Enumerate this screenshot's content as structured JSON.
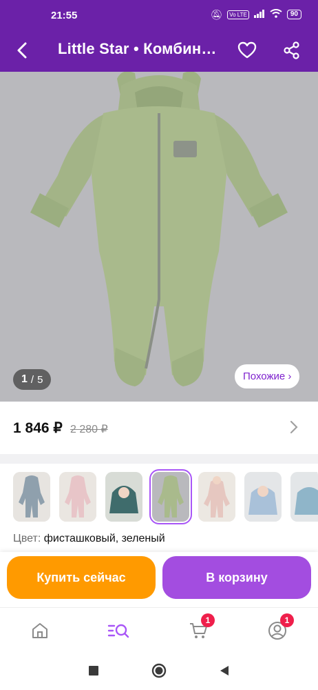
{
  "status_bar": {
    "time": "21:55",
    "sim_label": "Vo LTE",
    "battery": "90"
  },
  "header": {
    "title": "Little Star • Комбинезон",
    "icons": [
      "back-arrow-icon",
      "heart-icon",
      "share-icon"
    ]
  },
  "gallery": {
    "current": "1",
    "separator": "/",
    "total": "5",
    "similar_label": "Похожие ›",
    "background_color": "#b9b9bd",
    "garment_color": "#a9ba8c"
  },
  "price": {
    "current": "1 846 ₽",
    "old": "2 280 ₽"
  },
  "variants": {
    "thumbnails": [
      {
        "color": "#8fa0ad",
        "selected": false
      },
      {
        "color": "#e8c5c8",
        "selected": false
      },
      {
        "color": "#3f6c6c",
        "selected": false
      },
      {
        "color": "#a9ba8c",
        "selected": true
      },
      {
        "color": "#e6c7c0",
        "selected": false
      },
      {
        "color": "#a9c1d9",
        "selected": false
      },
      {
        "color": "#8fb5c9",
        "selected": false
      }
    ],
    "color_label": "Цвет:",
    "color_value": "фисташковый, зеленый"
  },
  "actions": {
    "buy_now": "Купить сейчас",
    "add_to_cart": "В корзину",
    "buy_color": "#ff9a00",
    "cart_color": "#a34de0"
  },
  "bottom_nav": {
    "items": [
      {
        "icon": "home-icon",
        "badge": ""
      },
      {
        "icon": "catalog-search-icon",
        "badge": ""
      },
      {
        "icon": "cart-icon",
        "badge": "1"
      },
      {
        "icon": "profile-icon",
        "badge": "1"
      }
    ]
  },
  "system_nav": [
    "square-recents-icon",
    "circle-home-icon",
    "triangle-back-icon"
  ],
  "colors": {
    "brand": "#6b21a8",
    "accent": "#a855f7",
    "badge": "#ef1f4b"
  }
}
